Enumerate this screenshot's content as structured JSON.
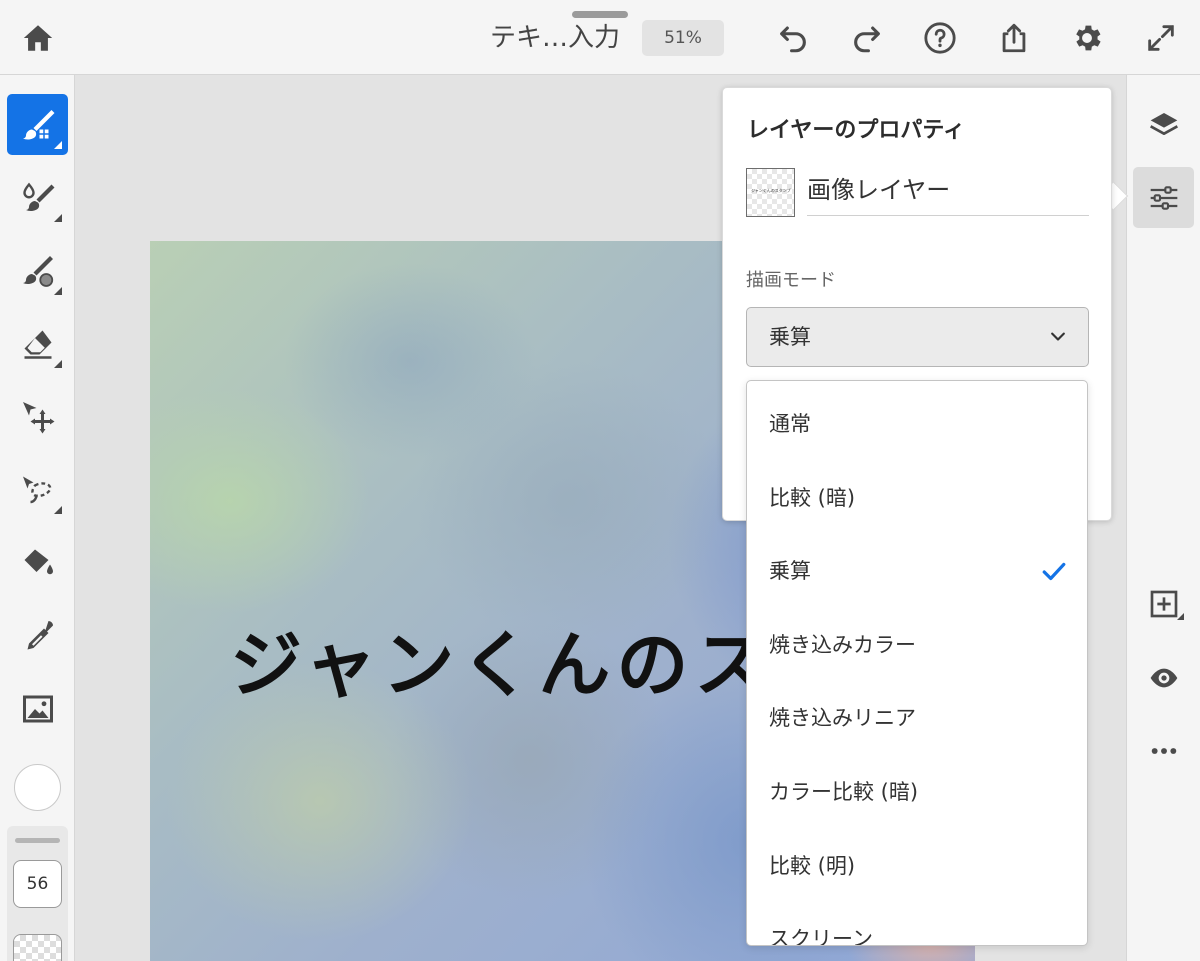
{
  "header": {
    "doc_title": "テキ…入力",
    "zoom": "51%",
    "icons": [
      "home-icon",
      "undo-icon",
      "redo-icon",
      "help-icon",
      "share-icon",
      "settings-icon",
      "fullscreen-icon"
    ]
  },
  "left_toolbar": {
    "tools": [
      "pixel-brush",
      "live-brush",
      "vector-brush",
      "eraser",
      "transform",
      "lasso-selection",
      "fill",
      "eyedropper",
      "image"
    ],
    "active_tool": "pixel-brush",
    "brush_size": "56",
    "color": "#ffffff"
  },
  "canvas": {
    "text": "ジャンくんのスタ"
  },
  "layer_properties": {
    "title": "レイヤーのプロパティ",
    "layer_name": "画像レイヤー",
    "thumb_text": "ジャンくんのスタンプ",
    "blend_mode_label": "描画モード",
    "blend_mode_value": "乗算"
  },
  "blend_options": [
    {
      "label": "通常",
      "selected": false
    },
    {
      "label": "比較 (暗)",
      "selected": false
    },
    {
      "label": "乗算",
      "selected": true
    },
    {
      "label": "焼き込みカラー",
      "selected": false
    },
    {
      "label": "焼き込みリニア",
      "selected": false
    },
    {
      "label": "カラー比較 (暗)",
      "selected": false
    },
    {
      "label": "比較 (明)",
      "selected": false
    },
    {
      "label": "スクリーン",
      "selected": false
    }
  ],
  "right_panel": {
    "icons": [
      "layers-icon",
      "layer-properties-icon",
      "add-layer-icon",
      "visibility-eye-icon",
      "more-icon"
    ]
  },
  "colors": {
    "accent": "#1473e6",
    "toolbar_bg": "#f5f5f5",
    "workspace_bg": "#e3e3e3"
  }
}
